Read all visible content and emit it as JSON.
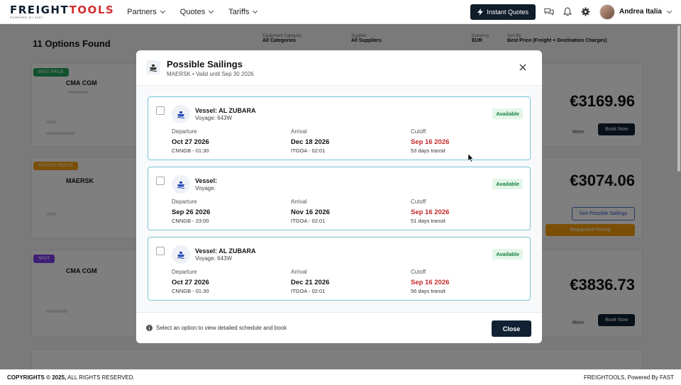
{
  "header": {
    "logo_text_main": "FREIGHT",
    "logo_text_accent": "TOOLS",
    "logo_sub": "POWERED BY FAST",
    "nav": [
      {
        "label": "Partners"
      },
      {
        "label": "Quotes"
      },
      {
        "label": "Tariffs"
      }
    ],
    "instant_label": "Instant Quotes",
    "user_name": "Andrea Italia"
  },
  "background": {
    "title": "11 Options Found",
    "filters": [
      {
        "label": "Equipment Category",
        "value": "All Categories"
      },
      {
        "label": "Supplier",
        "value": "All Suppliers"
      },
      {
        "label": "Currency",
        "value": "EUR"
      },
      {
        "label": "Sort By",
        "value": "Best Price (Freight + Destination Charges)"
      }
    ],
    "cards": [
      {
        "badge": "BEST PRICE",
        "badge_color": "#22a55a",
        "carrier": "CMA CGM",
        "price": "€3169.96",
        "btn_more": "More",
        "btn_main": "Book Now"
      },
      {
        "badge": "FASTEST ROUTE",
        "badge_color": "#f59e0b",
        "carrier": "MAERSK",
        "price": "€3074.06",
        "btn_more": "See Possible Sailings",
        "btn_main": "Requested Pricing"
      },
      {
        "badge": "SPOT",
        "badge_color": "#7c3aed",
        "carrier": "CMA CGM",
        "price": "€3836.73",
        "btn_more": "More",
        "btn_main": "Book Now"
      }
    ]
  },
  "modal": {
    "title": "Possible Sailings",
    "subtitle": "MAERSK • Valid until Sep 30 2026",
    "labels": {
      "departure": "Departure",
      "arrival": "Arrival",
      "cutoff": "Cutoff"
    },
    "sailings": [
      {
        "vessel": "Vessel: AL ZUBARA",
        "voyage": "Voyage: 643W",
        "status": "Available",
        "departure_date": "Oct 27 2026",
        "departure_port": "CNNGB - 01:30",
        "arrival_date": "Dec 18 2026",
        "arrival_port": "ITGOA - 02:01",
        "cutoff_date": "Sep 16 2026",
        "transit": "53 days transit"
      },
      {
        "vessel": "Vessel:",
        "voyage": "Voyage:",
        "status": "Available",
        "departure_date": "Sep 26 2026",
        "departure_port": "CNNGB - 23:00",
        "arrival_date": "Nov 16 2026",
        "arrival_port": "ITGOA - 02:01",
        "cutoff_date": "Sep 16 2026",
        "transit": "51 days transit"
      },
      {
        "vessel": "Vessel: AL ZUBARA",
        "voyage": "Voyage: 643W",
        "status": "Available",
        "departure_date": "Oct 27 2026",
        "departure_port": "CNNGB - 01:30",
        "arrival_date": "Dec 21 2026",
        "arrival_port": "ITGOA - 02:01",
        "cutoff_date": "Sep 16 2026",
        "transit": "56 days transit"
      }
    ],
    "info": "Select an option to view detailed schedule and book",
    "close_label": "Close"
  },
  "footer": {
    "copyright_bold": "COPYRIGHTS © 2025,",
    "copyright_rest": " ALL RIGHTS RESERVED.",
    "right": "FREIGHTOOLS, Powered By FAST"
  },
  "colors": {
    "accent_dark": "#102233",
    "available_green": "#15803d",
    "cutoff_red": "#c62828",
    "card_border": "#7cc4d8"
  }
}
